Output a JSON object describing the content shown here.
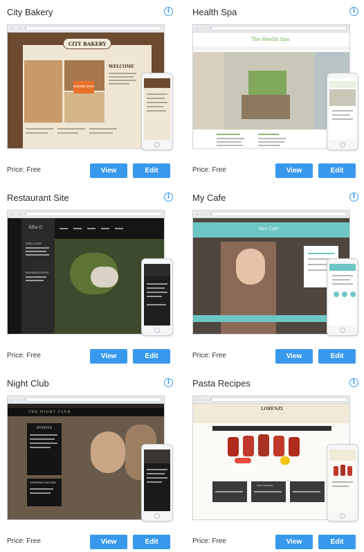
{
  "price_label": "Price:",
  "price_value": "Free",
  "view_label": "View",
  "edit_label": "Edit",
  "info_glyph": "i",
  "browser_nav": "← → C",
  "colors": {
    "accent": "#3899ec",
    "title": "#2b2b2b"
  },
  "icons": [
    "info-icon",
    "browser-back-icon",
    "phone-home-button-icon"
  ],
  "templates": [
    {
      "title": "City Bakery",
      "brand": "CITY BAKERY",
      "badge": "PASTRY LOVE",
      "headline": "WELCOME"
    },
    {
      "title": "Health Spa",
      "brand": "The Health Spa"
    },
    {
      "title": "Restaurant Site",
      "brand": "Alba G",
      "headline": "WELCOME",
      "sub": "RESERVATIONS"
    },
    {
      "title": "My Cafe",
      "brand": "Alex Cafe"
    },
    {
      "title": "Night Club",
      "brand": "THE NIGHT CLUB",
      "headline": "EVENTS",
      "sub": "OPENING HOURS"
    },
    {
      "title": "Pasta Recipes",
      "brand": "LORENZI",
      "sub": "Our Sauces"
    }
  ]
}
